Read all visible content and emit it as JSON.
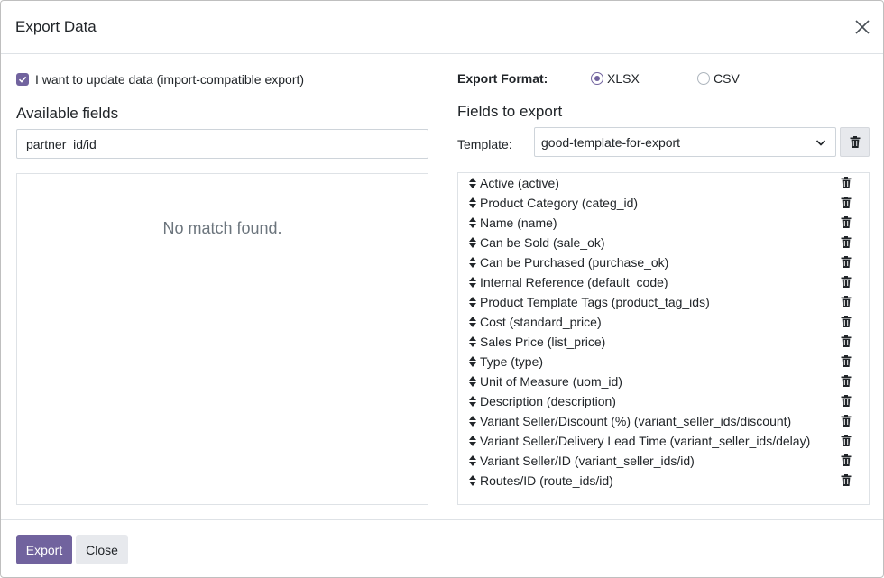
{
  "dialog": {
    "title": "Export Data"
  },
  "left": {
    "import_compatible_label": "I want to update data (import-compatible export)",
    "import_compatible_checked": true,
    "available_title": "Available fields",
    "search_value": "partner_id/id",
    "no_match_text": "No match found."
  },
  "right": {
    "format_label": "Export Format:",
    "formats": [
      {
        "label": "XLSX",
        "selected": true
      },
      {
        "label": "CSV",
        "selected": false
      }
    ],
    "fields_title": "Fields to export",
    "template_label": "Template:",
    "template_value": "good-template-for-export",
    "fields": [
      "Active (active)",
      "Product Category (categ_id)",
      "Name (name)",
      "Can be Sold (sale_ok)",
      "Can be Purchased (purchase_ok)",
      "Internal Reference (default_code)",
      "Product Template Tags (product_tag_ids)",
      "Cost (standard_price)",
      "Sales Price (list_price)",
      "Type (type)",
      "Unit of Measure (uom_id)",
      "Description (description)",
      "Variant Seller/Discount (%) (variant_seller_ids/discount)",
      "Variant Seller/Delivery Lead Time (variant_seller_ids/delay)",
      "Variant Seller/ID (variant_seller_ids/id)",
      "Routes/ID (route_ids/id)"
    ]
  },
  "footer": {
    "export_label": "Export",
    "close_label": "Close"
  },
  "colors": {
    "accent": "#71639e",
    "secondary_button": "#e7e9ed",
    "muted_text": "#6c757d"
  },
  "icons": [
    "close-icon",
    "checkbox-checked-icon",
    "chevron-down-icon",
    "trash-icon",
    "sort-handle-icon"
  ]
}
